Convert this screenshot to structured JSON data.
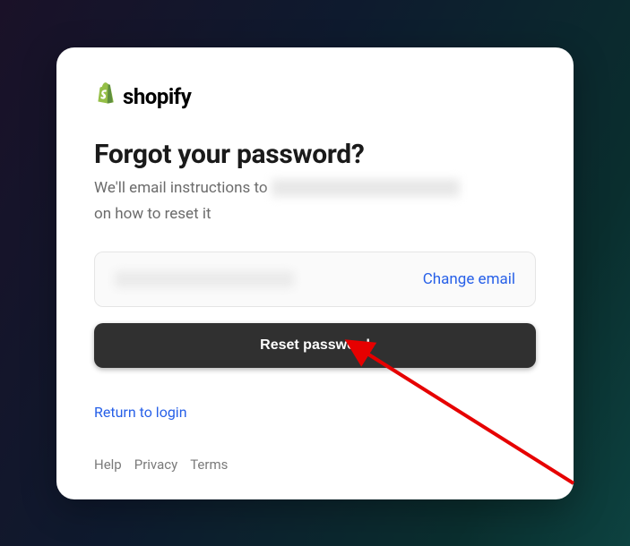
{
  "brand": {
    "name": "shopify"
  },
  "heading": "Forgot your password?",
  "subtext_prefix": "We'll email instructions to",
  "subtext_suffix": "on how to reset it",
  "email_box": {
    "change_label": "Change email"
  },
  "reset_button": "Reset password",
  "return_link": "Return to login",
  "footer": {
    "help": "Help",
    "privacy": "Privacy",
    "terms": "Terms"
  }
}
